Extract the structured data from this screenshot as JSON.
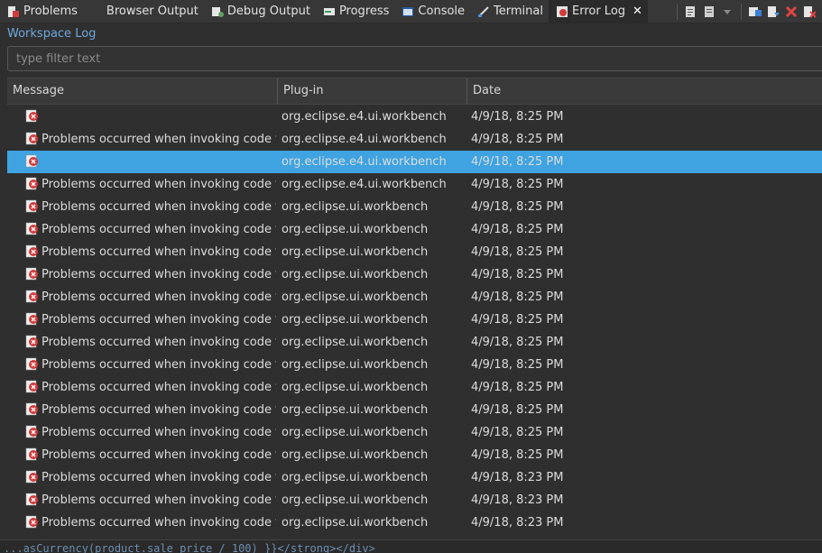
{
  "tabs": [
    {
      "label": "Problems",
      "icon": "problems-icon",
      "active": false
    },
    {
      "label": "Browser Output",
      "icon": "browser-output-icon",
      "active": false
    },
    {
      "label": "Debug Output",
      "icon": "debug-output-icon",
      "active": false
    },
    {
      "label": "Progress",
      "icon": "progress-icon",
      "active": false
    },
    {
      "label": "Console",
      "icon": "console-icon",
      "active": false
    },
    {
      "label": "Terminal",
      "icon": "terminal-icon",
      "active": false
    },
    {
      "label": "Error Log",
      "icon": "error-log-icon",
      "active": true
    }
  ],
  "workspace_log_label": "Workspace Log",
  "filter": {
    "placeholder": "type filter text",
    "value": ""
  },
  "columns": {
    "message": "Message",
    "plugin": "Plug-in",
    "date": "Date"
  },
  "rows": [
    {
      "message": "",
      "plugin": "org.eclipse.e4.ui.workbench",
      "date": "4/9/18, 8:25 PM",
      "selected": false
    },
    {
      "message": "Problems occurred when invoking code from",
      "plugin": "org.eclipse.e4.ui.workbench",
      "date": "4/9/18, 8:25 PM",
      "selected": false
    },
    {
      "message": "",
      "plugin": "org.eclipse.e4.ui.workbench",
      "date": "4/9/18, 8:25 PM",
      "selected": true
    },
    {
      "message": "Problems occurred when invoking code from",
      "plugin": "org.eclipse.e4.ui.workbench",
      "date": "4/9/18, 8:25 PM",
      "selected": false
    },
    {
      "message": "Problems occurred when invoking code from",
      "plugin": "org.eclipse.ui.workbench",
      "date": "4/9/18, 8:25 PM",
      "selected": false
    },
    {
      "message": "Problems occurred when invoking code from",
      "plugin": "org.eclipse.ui.workbench",
      "date": "4/9/18, 8:25 PM",
      "selected": false
    },
    {
      "message": "Problems occurred when invoking code from",
      "plugin": "org.eclipse.ui.workbench",
      "date": "4/9/18, 8:25 PM",
      "selected": false
    },
    {
      "message": "Problems occurred when invoking code from",
      "plugin": "org.eclipse.ui.workbench",
      "date": "4/9/18, 8:25 PM",
      "selected": false
    },
    {
      "message": "Problems occurred when invoking code from",
      "plugin": "org.eclipse.ui.workbench",
      "date": "4/9/18, 8:25 PM",
      "selected": false
    },
    {
      "message": "Problems occurred when invoking code from",
      "plugin": "org.eclipse.ui.workbench",
      "date": "4/9/18, 8:25 PM",
      "selected": false
    },
    {
      "message": "Problems occurred when invoking code from",
      "plugin": "org.eclipse.ui.workbench",
      "date": "4/9/18, 8:25 PM",
      "selected": false
    },
    {
      "message": "Problems occurred when invoking code from",
      "plugin": "org.eclipse.ui.workbench",
      "date": "4/9/18, 8:25 PM",
      "selected": false
    },
    {
      "message": "Problems occurred when invoking code from",
      "plugin": "org.eclipse.ui.workbench",
      "date": "4/9/18, 8:25 PM",
      "selected": false
    },
    {
      "message": "Problems occurred when invoking code from",
      "plugin": "org.eclipse.ui.workbench",
      "date": "4/9/18, 8:25 PM",
      "selected": false
    },
    {
      "message": "Problems occurred when invoking code from",
      "plugin": "org.eclipse.ui.workbench",
      "date": "4/9/18, 8:25 PM",
      "selected": false
    },
    {
      "message": "Problems occurred when invoking code from",
      "plugin": "org.eclipse.ui.workbench",
      "date": "4/9/18, 8:25 PM",
      "selected": false
    },
    {
      "message": "Problems occurred when invoking code from",
      "plugin": "org.eclipse.ui.workbench",
      "date": "4/9/18, 8:23 PM",
      "selected": false
    },
    {
      "message": "Problems occurred when invoking code from",
      "plugin": "org.eclipse.ui.workbench",
      "date": "4/9/18, 8:23 PM",
      "selected": false
    },
    {
      "message": "Problems occurred when invoking code from",
      "plugin": "org.eclipse.ui.workbench",
      "date": "4/9/18, 8:23 PM",
      "selected": false
    }
  ],
  "editor_code": "...asCurrency(product.sale_price / 100) }}</strong></div>",
  "colors": {
    "background": "#2f2f2f",
    "selected_row": "#3ea3e0",
    "link": "#6fa8dc",
    "error_icon": "#d23b3b"
  }
}
